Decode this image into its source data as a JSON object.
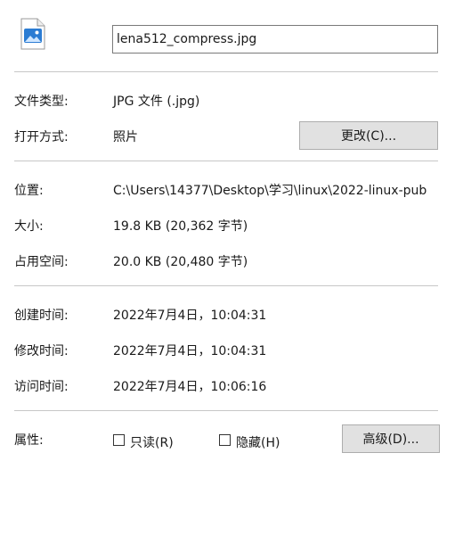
{
  "file": {
    "icon": "image-file-icon",
    "name": "lena512_compress.jpg"
  },
  "type_row": {
    "label": "文件类型:",
    "value": "JPG 文件 (.jpg)"
  },
  "opens_with_row": {
    "label": "打开方式:",
    "value": "照片",
    "button_label": "更改(C)..."
  },
  "location_row": {
    "label": "位置:",
    "value": "C:\\Users\\14377\\Desktop\\学习\\linux\\2022-linux-pub"
  },
  "size_row": {
    "label": "大小:",
    "value": "19.8 KB (20,362 字节)"
  },
  "size_on_disk_row": {
    "label": "占用空间:",
    "value": "20.0 KB (20,480 字节)"
  },
  "created_row": {
    "label": "创建时间:",
    "value": "2022年7月4日，10:04:31"
  },
  "modified_row": {
    "label": "修改时间:",
    "value": "2022年7月4日，10:04:31"
  },
  "accessed_row": {
    "label": "访问时间:",
    "value": "2022年7月4日，10:06:16"
  },
  "attributes": {
    "label": "属性:",
    "readonly_label": "只读(R)",
    "readonly_checked": false,
    "hidden_label": "隐藏(H)",
    "hidden_checked": false,
    "advanced_button_label": "高级(D)..."
  },
  "colors": {
    "icon_blue": "#2b7cd3",
    "button_bg": "#e1e1e1",
    "separator": "#c7c7c7"
  }
}
